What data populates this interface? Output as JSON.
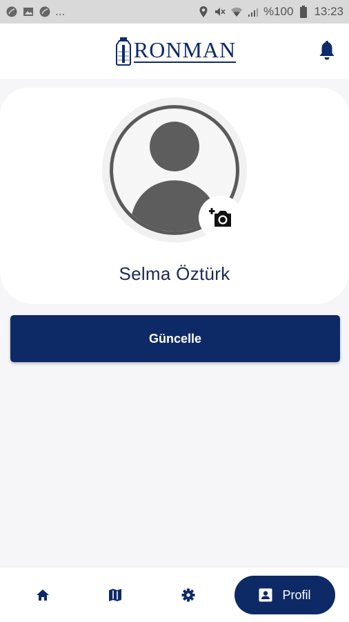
{
  "status_bar": {
    "battery_text": "%100",
    "time": "13:23",
    "more": "..."
  },
  "header": {
    "logo_text": "RONMAN"
  },
  "profile": {
    "name": "Selma Öztürk"
  },
  "actions": {
    "update_label": "Güncelle"
  },
  "bottom_nav": {
    "active_label": "Profil"
  },
  "colors": {
    "primary": "#0d2a66",
    "background": "#f6f6f8"
  }
}
